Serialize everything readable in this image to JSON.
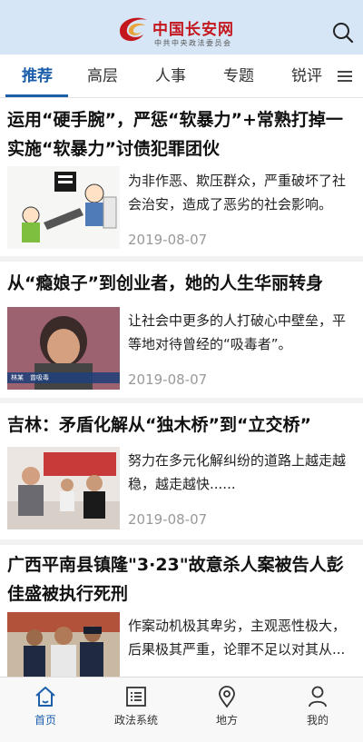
{
  "header": {
    "logo_title": "中国长安网",
    "logo_subtitle": "中共中央政法委员会",
    "search_icon": "search-icon",
    "brand_color": "#c4171d",
    "header_bg": "#d6e6f6"
  },
  "tabs": {
    "items": [
      {
        "label": "推荐",
        "active": true
      },
      {
        "label": "高层",
        "active": false
      },
      {
        "label": "人事",
        "active": false
      },
      {
        "label": "专题",
        "active": false
      },
      {
        "label": "锐评",
        "active": false
      }
    ],
    "menu_icon": "menu-icon",
    "accent_color": "#1b5fab"
  },
  "articles": [
    {
      "title": "运用“硬手腕”，严惩“软暴力”+常熟打掉一实施“软暴力”讨债犯罪团伙",
      "summary": "为非作恶、欺压群众，严重破坏了社会治安，造成了恶劣的社会影响。",
      "date": "2019-08-07"
    },
    {
      "title": "从“瘾娘子”到创业者，她的人生华丽转身",
      "summary": "让社会中更多的人打破心中壁垒，平等地对待曾经的“吸毒者”。",
      "date": "2019-08-07",
      "thumb_caption": "林某　曾吸毒"
    },
    {
      "title": "吉林：矛盾化解从“独木桥”到“立交桥”",
      "summary": "努力在多元化解纠纷的道路上越走越稳，越走越快......",
      "date": "2019-08-07"
    },
    {
      "title": "广西平南县镇隆\"3·23\"故意杀人案被告人彭佳盛被执行死刑",
      "summary": "作案动机极其卑劣，主观恶性极大，后果极其严重，论罪不足以对其从..."
    }
  ],
  "bottom_nav": {
    "items": [
      {
        "label": "首页",
        "icon": "home-icon",
        "active": true
      },
      {
        "label": "政法系统",
        "icon": "list-icon",
        "active": false
      },
      {
        "label": "地方",
        "icon": "location-icon",
        "active": false
      },
      {
        "label": "我的",
        "icon": "user-icon",
        "active": false
      }
    ]
  }
}
